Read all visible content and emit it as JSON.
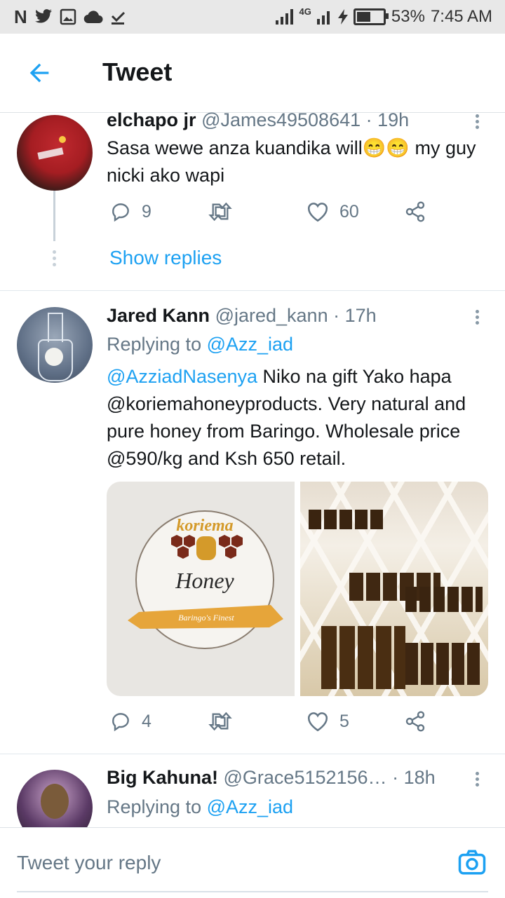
{
  "status_bar": {
    "left_icons": [
      "N",
      "twitter-icon",
      "gallery-icon",
      "cloud-icon",
      "download-done-icon"
    ],
    "network": "4G",
    "battery": "53%",
    "battery_fraction": 0.53,
    "time": "7:45 AM"
  },
  "header": {
    "title": "Tweet"
  },
  "tweets": [
    {
      "name": "elchapo jr",
      "handle": "@James49508641",
      "time": "· 19h",
      "text": "Sasa wewe anza kuandika will",
      "text_emoji": "😁😁",
      "text_end": " my guy nicki ako wapi",
      "replies": "9",
      "likes": "60",
      "show_replies": "Show replies"
    },
    {
      "name": "Jared Kann",
      "handle": "@jared_kann",
      "time": "· 17h",
      "replying_label": "Replying to ",
      "replying_to": "@Azz_iad",
      "mention": "@AzziadNasenya",
      "text": " Niko na gift Yako hapa @koriemahoneyproducts. Very natural and pure honey from Baringo. Wholesale price @590/kg and Ksh 650 retail.",
      "logo_text": "koriema",
      "logo_sub": "Honey",
      "logo_banner": "Baringo's Finest",
      "replies": "4",
      "likes": "5"
    },
    {
      "name": "Big Kahuna!",
      "handle": "@Grace5152156…",
      "time": "· 18h",
      "replying_label": "Replying to ",
      "replying_to": "@Azz_iad"
    }
  ],
  "composer": {
    "placeholder": "Tweet your reply"
  },
  "colors": {
    "accent": "#1da1f2",
    "muted": "#657786",
    "text": "#14171a"
  }
}
